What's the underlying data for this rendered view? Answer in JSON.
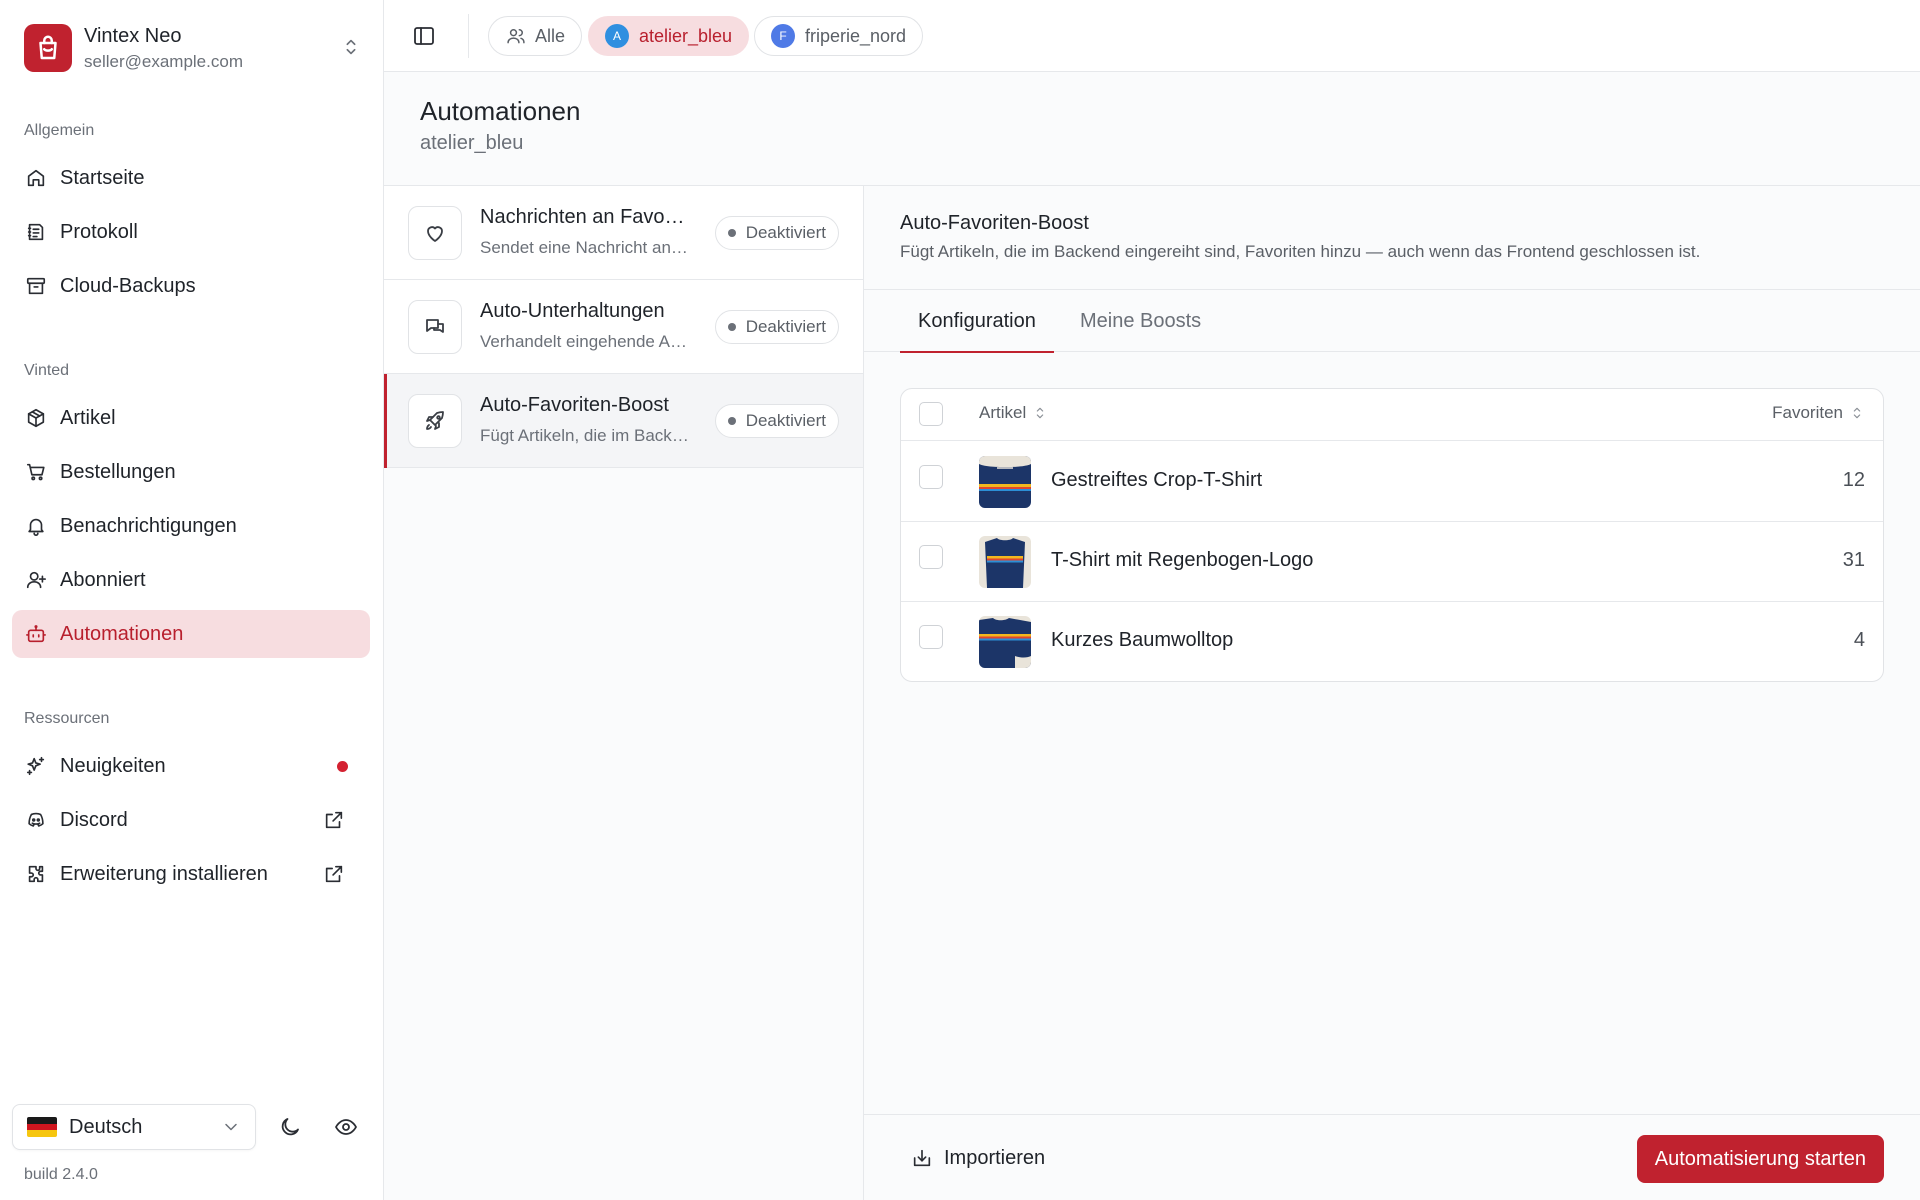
{
  "account": {
    "name": "Vintex Neo",
    "email": "seller@example.com",
    "brand_color": "#c0222f"
  },
  "sidebar": {
    "sections": [
      {
        "label": "Allgemein"
      },
      {
        "label": "Vinted"
      },
      {
        "label": "Ressourcen"
      }
    ],
    "items": [
      {
        "label": "Startseite",
        "icon": "home-icon"
      },
      {
        "label": "Protokoll",
        "icon": "log-icon"
      },
      {
        "label": "Cloud-Backups",
        "icon": "archive-icon"
      },
      {
        "label": "Artikel",
        "icon": "package-icon"
      },
      {
        "label": "Bestellungen",
        "icon": "cart-icon"
      },
      {
        "label": "Benachrichtigungen",
        "icon": "bell-icon"
      },
      {
        "label": "Abonniert",
        "icon": "user-plus-icon"
      },
      {
        "label": "Automationen",
        "icon": "bot-icon",
        "active": true
      },
      {
        "label": "Neuigkeiten",
        "icon": "sparkles-icon",
        "badge": "unread-dot"
      },
      {
        "label": "Discord",
        "icon": "discord-icon",
        "trail_icon": "external-link-icon"
      },
      {
        "label": "Erweiterung installieren",
        "icon": "puzzle-icon",
        "trail_icon": "external-link-icon"
      }
    ],
    "language": "Deutsch",
    "build": "build 2.4.0"
  },
  "topbar": {
    "chips": [
      {
        "label": "Alle",
        "icon": "users-icon"
      },
      {
        "label": "atelier_bleu",
        "avatar": "A",
        "avatar_color": "#2f8fe0",
        "active": true
      },
      {
        "label": "friperie_nord",
        "avatar": "F",
        "avatar_color": "#4f7ae6"
      }
    ]
  },
  "page": {
    "title": "Automationen",
    "subtitle": "atelier_bleu"
  },
  "automations": [
    {
      "title": "Nachrichten an Favoriten",
      "desc": "Sendet eine Nachricht an Nutzer, die Artikel favorisieren",
      "status": "Deaktiviert",
      "icon": "heart-icon"
    },
    {
      "title": "Auto-Unterhaltungen",
      "desc": "Verhandelt eingehende Angebote automatisch",
      "status": "Deaktiviert",
      "icon": "chat-icon"
    },
    {
      "title": "Auto-Favoriten-Boost",
      "desc": "Fügt Artikeln, die im Backend eingereiht sind, Favoriten hinzu",
      "status": "Deaktiviert",
      "icon": "rocket-icon",
      "active": true
    }
  ],
  "detail": {
    "title": "Auto-Favoriten-Boost",
    "desc": "Fügt Artikeln, die im Backend eingereiht sind, Favoriten hinzu — auch wenn das Frontend geschlossen ist.",
    "tabs": [
      {
        "label": "Konfiguration",
        "active": true
      },
      {
        "label": "Meine Boosts"
      }
    ],
    "table": {
      "headers": {
        "article": "Artikel",
        "favorites": "Favoriten"
      },
      "rows": [
        {
          "name": "Gestreiftes Crop-T-Shirt",
          "favorites": "12"
        },
        {
          "name": "T-Shirt mit Regenbogen-Logo",
          "favorites": "31"
        },
        {
          "name": "Kurzes Baumwolltop",
          "favorites": "4"
        }
      ]
    },
    "import_label": "Importieren",
    "start_label": "Automatisierung starten"
  }
}
